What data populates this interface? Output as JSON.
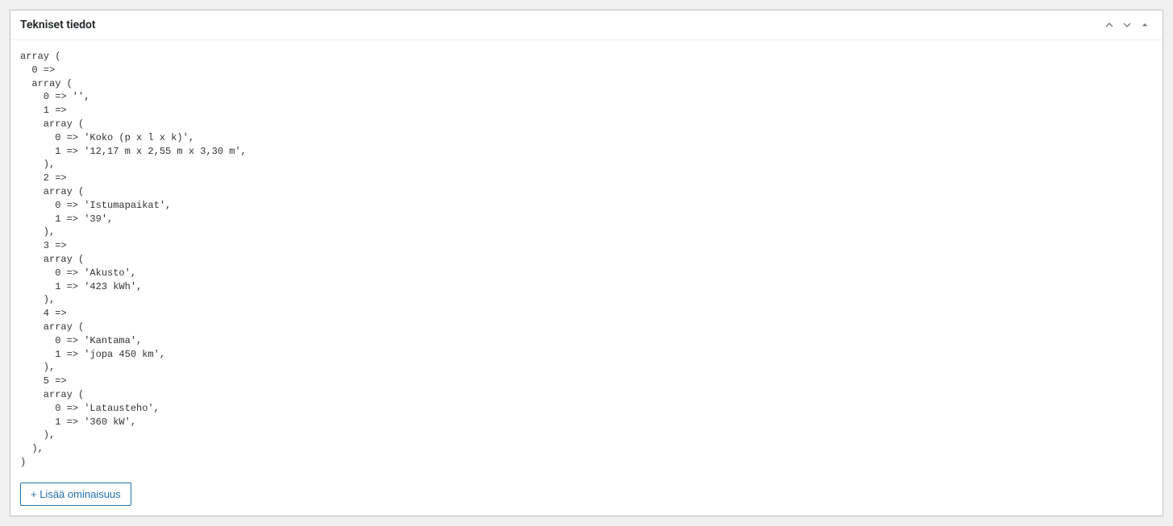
{
  "metabox": {
    "title": "Tekniset tiedot",
    "add_button_label": "+ Lisää ominaisuus"
  },
  "debug_output": "array (\n  0 => \n  array (\n    0 => '',\n    1 => \n    array (\n      0 => 'Koko (p x l x k)',\n      1 => '12,17 m x 2,55 m x 3,30 m',\n    ),\n    2 => \n    array (\n      0 => 'Istumapaikat',\n      1 => '39',\n    ),\n    3 => \n    array (\n      0 => 'Akusto',\n      1 => '423 kWh',\n    ),\n    4 => \n    array (\n      0 => 'Kantama',\n      1 => 'jopa 450 km',\n    ),\n    5 => \n    array (\n      0 => 'Latausteho',\n      1 => '360 kW',\n    ),\n  ),\n)"
}
